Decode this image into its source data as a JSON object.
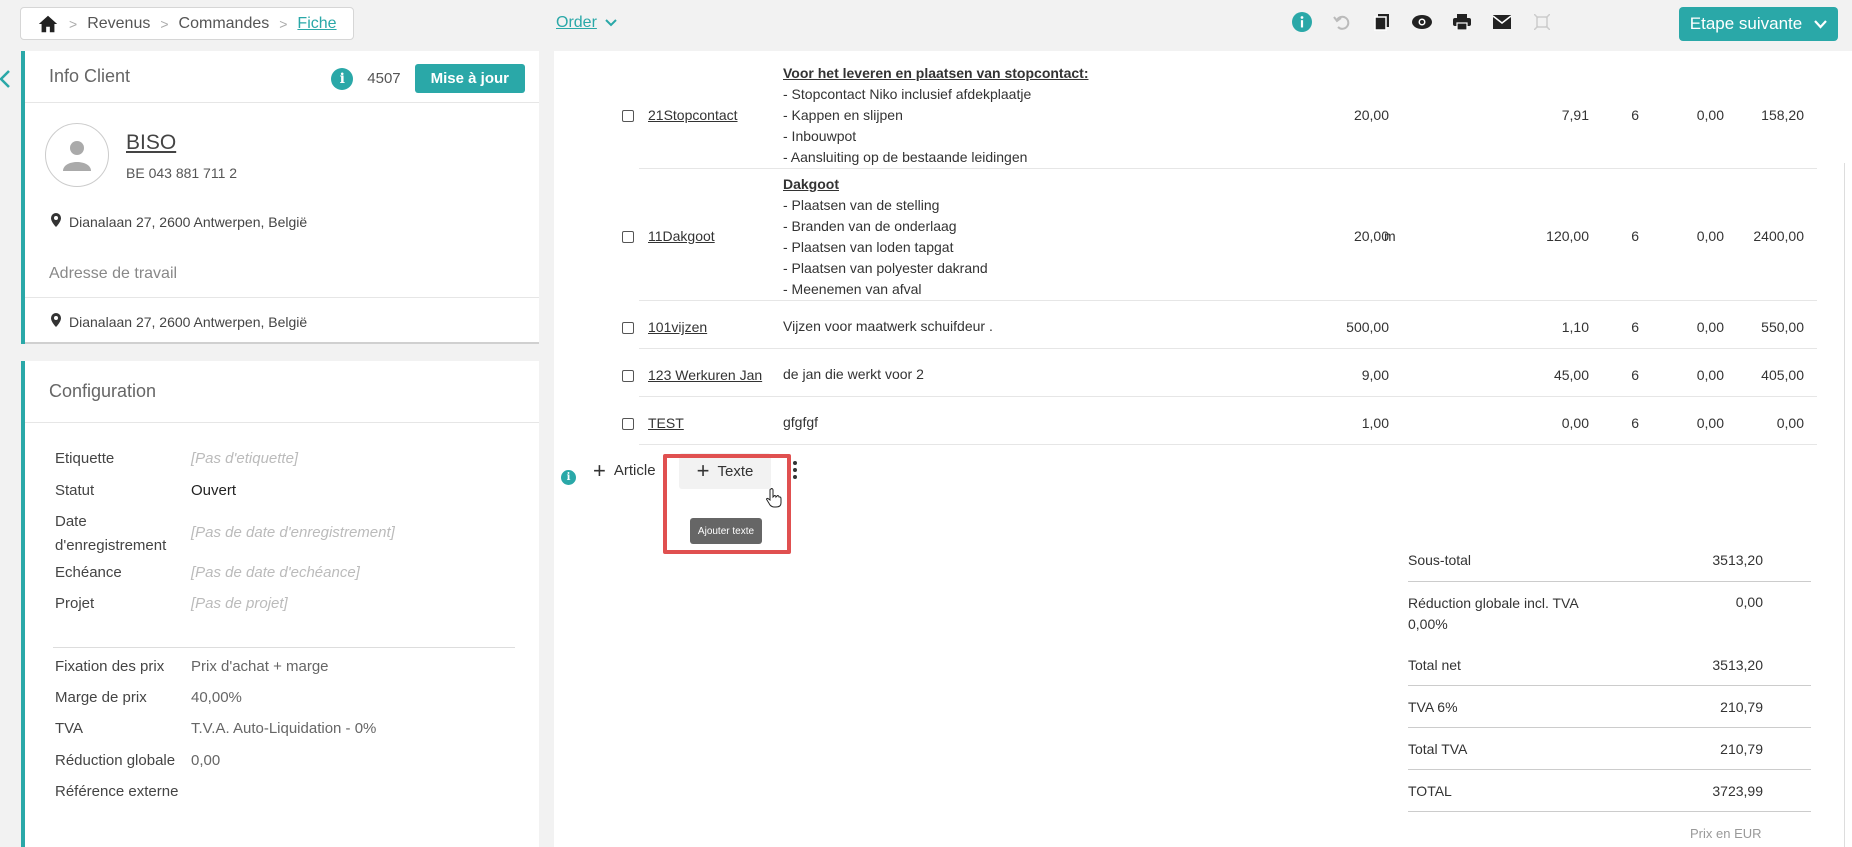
{
  "breadcrumb": {
    "items": [
      "Revenus",
      "Commandes"
    ],
    "current": "Fiche"
  },
  "header": {
    "order_label": "Order",
    "next_step_label": "Etape suivante"
  },
  "client": {
    "title": "Info Client",
    "number": "4507",
    "update_label": "Mise à jour",
    "name": "BISO",
    "vat": "BE 043 881 711 2",
    "address": "Dianalaan 27, 2600 Antwerpen, België",
    "work_address_label": "Adresse de travail",
    "work_address": "Dianalaan 27, 2600 Antwerpen, België"
  },
  "config": {
    "title": "Configuration",
    "rows": [
      {
        "label": "Etiquette",
        "value": "[Pas d'etiquette]"
      },
      {
        "label": "Statut",
        "value": "Ouvert"
      },
      {
        "label": "Date d'enregistrement",
        "value": "[Pas de date d'enregistrement]"
      },
      {
        "label": "Echéance",
        "value": "[Pas de date d'echéance]"
      },
      {
        "label": "Projet",
        "value": "[Pas de projet]"
      },
      {
        "label": "Fixation des prix",
        "value": "Prix d'achat + marge"
      },
      {
        "label": "Marge de prix",
        "value": "40,00%"
      },
      {
        "label": "TVA",
        "value": "T.V.A. Auto-Liquidation - 0%"
      },
      {
        "label": "Réduction globale",
        "value": "0,00"
      },
      {
        "label": "Référence externe",
        "value": ""
      }
    ]
  },
  "lines": [
    {
      "code": "21Stopcontact",
      "title": "Voor het leveren en plaatsen van stopcontact:",
      "desc": [
        "- Stopcontact Niko inclusief afdekplaatje",
        "- Kappen en slijpen",
        "- Inbouwpot",
        "- Aansluiting op de bestaande leidingen"
      ],
      "qty": "20,00",
      "unit": "",
      "price": "7,91",
      "vat": "6",
      "discount": "0,00",
      "total": "158,20"
    },
    {
      "code": "11Dakgoot",
      "title": "Dakgoot",
      "desc": [
        "- Plaatsen van de stelling",
        "- Branden van de onderlaag",
        "- Plaatsen van loden tapgat",
        "- Plaatsen van polyester dakrand",
        "- Meenemen van afval"
      ],
      "qty": "20,00",
      "unit": "m",
      "price": "120,00",
      "vat": "6",
      "discount": "0,00",
      "total": "2400,00"
    },
    {
      "code": "101vijzen",
      "title": "",
      "desc": [
        "Vijzen voor maatwerk schuifdeur ."
      ],
      "qty": "500,00",
      "unit": "",
      "price": "1,10",
      "vat": "6",
      "discount": "0,00",
      "total": "550,00"
    },
    {
      "code": "123 Werkuren Jan",
      "title": "",
      "desc": [
        "de jan die werkt voor 2"
      ],
      "qty": "9,00",
      "unit": "",
      "price": "45,00",
      "vat": "6",
      "discount": "0,00",
      "total": "405,00"
    },
    {
      "code": "TEST",
      "title": "",
      "desc": [
        "gfgfgf"
      ],
      "qty": "1,00",
      "unit": "",
      "price": "0,00",
      "vat": "6",
      "discount": "0,00",
      "total": "0,00"
    }
  ],
  "actions": {
    "article_label": "Article",
    "texte_label": "Texte",
    "tooltip": "Ajouter texte"
  },
  "totals": [
    {
      "label": "Sous-total",
      "value": "3513,20"
    },
    {
      "label": "Réduction globale incl. TVA 0,00%",
      "value": "0,00"
    },
    {
      "label": "Total net",
      "value": "3513,20"
    },
    {
      "label": "TVA 6%",
      "value": "210,79"
    },
    {
      "label": "Total TVA",
      "value": "210,79"
    },
    {
      "label": "TOTAL",
      "value": "3723,99"
    }
  ],
  "currency_note": "Prix en EUR",
  "colors": {
    "accent": "#2aa8a8",
    "highlight": "#e05050"
  }
}
